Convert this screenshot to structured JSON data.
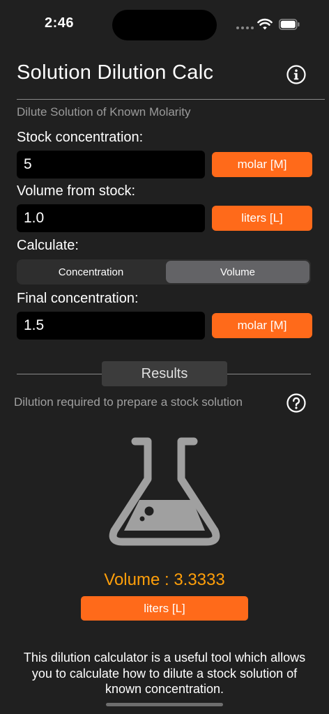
{
  "status_bar": {
    "time": "2:46"
  },
  "header": {
    "title": "Solution Dilution Calc"
  },
  "subtitle": "Dilute Solution of Known Molarity",
  "fields": {
    "stock_concentration": {
      "label": "Stock concentration:",
      "value": "5",
      "unit": "molar [M]"
    },
    "volume_from_stock": {
      "label": "Volume from stock:",
      "value": "1.0",
      "unit": "liters [L]"
    },
    "final_concentration": {
      "label": "Final concentration:",
      "value": "1.5",
      "unit": "molar [M]"
    }
  },
  "calculate": {
    "label": "Calculate:",
    "options": [
      "Concentration",
      "Volume"
    ],
    "selected": "Volume"
  },
  "results": {
    "tab_label": "Results",
    "description": "Dilution required to prepare a stock solution",
    "value_text": "Volume : 3.3333",
    "unit": "liters [L]"
  },
  "footer": "This dilution calculator is a useful tool which allows you to calculate how to dilute a stock solution of known concentration.",
  "colors": {
    "background": "#202020",
    "accent": "#ff6a1a",
    "result_text": "#ff9f0a",
    "segment_selected": "#636366"
  },
  "icons": [
    "info-icon",
    "help-icon",
    "flask-icon",
    "wifi-icon",
    "battery-icon"
  ]
}
